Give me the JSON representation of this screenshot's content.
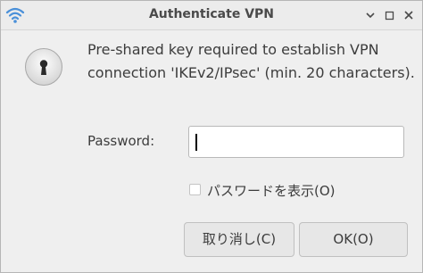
{
  "window": {
    "title": "Authenticate VPN",
    "app_icon": "wifi-icon",
    "controls": [
      "minimize-icon",
      "maximize-icon",
      "close-icon"
    ]
  },
  "dialog": {
    "icon": "lock-icon",
    "message": "Pre-shared key required to establish VPN connection 'IKEv2/IPsec' (min. 20 characters).",
    "password_label": "Password:",
    "password_value": "",
    "show_password_label": "パスワードを表示(O)",
    "show_password_checked": false,
    "cancel_label": "取り消し(C)",
    "ok_label": "OK(O)"
  },
  "colors": {
    "accent": "#4a90d9",
    "window_bg": "#efefef",
    "text": "#3c3c3c"
  }
}
